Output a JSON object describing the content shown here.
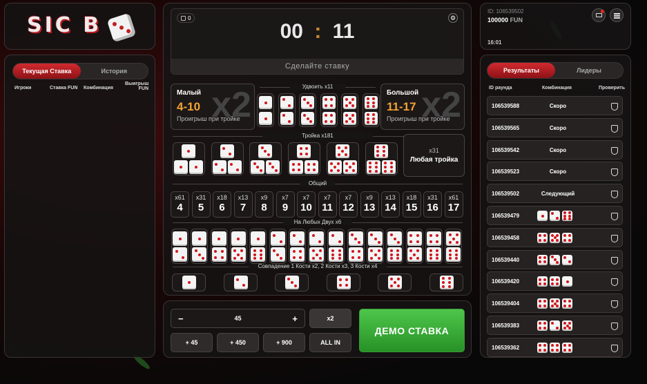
{
  "logo": {
    "text": "SIC B"
  },
  "left": {
    "tab_current": "Текущая Ставка",
    "tab_history": "История",
    "col_players": "Игроки",
    "col_stake": "Ставка FUN",
    "col_combo": "Комбинация",
    "col_win": "Выигрыш FUN"
  },
  "top": {
    "badge_count": "0",
    "timer_min": "00",
    "timer_sep": ":",
    "timer_sec": "11",
    "status": "Сделайте ставку"
  },
  "small": {
    "title": "Малый",
    "range": "4-10",
    "note": "Проигрыш при тройке",
    "mult": "x2"
  },
  "big": {
    "title": "Большой",
    "range": "11-17",
    "note": "Проигрыш при тройке",
    "mult": "x2"
  },
  "sections": {
    "double": "Удвоить x11",
    "triple": "Тройка x181",
    "total": "Общий",
    "two": "На Любых Двух x6",
    "single": "Совпадение 1 Кости x2, 2 Кости x3, 3 Кости x4"
  },
  "any_triple": {
    "mult": "x31",
    "label": "Любая тройка"
  },
  "totals": [
    {
      "m": "x61",
      "n": "4"
    },
    {
      "m": "x31",
      "n": "5"
    },
    {
      "m": "x18",
      "n": "6"
    },
    {
      "m": "x13",
      "n": "7"
    },
    {
      "m": "x9",
      "n": "8"
    },
    {
      "m": "x7",
      "n": "9"
    },
    {
      "m": "x7",
      "n": "10"
    },
    {
      "m": "x7",
      "n": "11"
    },
    {
      "m": "x7",
      "n": "12"
    },
    {
      "m": "x9",
      "n": "13"
    },
    {
      "m": "x13",
      "n": "14"
    },
    {
      "m": "x18",
      "n": "15"
    },
    {
      "m": "x31",
      "n": "16"
    },
    {
      "m": "x61",
      "n": "17"
    }
  ],
  "bet": {
    "minus": "−",
    "amount": "45",
    "plus": "+",
    "double": "x2",
    "add45": "+ 45",
    "add450": "+ 450",
    "add900": "+ 900",
    "allin": "ALL IN",
    "demo": "ДЕМО СТАВКА"
  },
  "account": {
    "id": "ID: 106539502",
    "balance": "100000",
    "currency": "FUN",
    "time": "16:01"
  },
  "right": {
    "tab_results": "Результаты",
    "tab_leaders": "Лидеры",
    "col_round": "ID раунда",
    "col_combo": "Комбинация",
    "col_check": "Проверить"
  },
  "results": [
    {
      "id": "106539588",
      "status": "Скоро",
      "dice": []
    },
    {
      "id": "106539565",
      "status": "Скоро",
      "dice": []
    },
    {
      "id": "106539542",
      "status": "Скоро",
      "dice": []
    },
    {
      "id": "106539523",
      "status": "Скоро",
      "dice": []
    },
    {
      "id": "106539502",
      "status": "Следующий",
      "dice": []
    },
    {
      "id": "106539479",
      "status": "",
      "dice": [
        1,
        2,
        6
      ]
    },
    {
      "id": "106539458",
      "status": "",
      "dice": [
        4,
        5,
        4
      ]
    },
    {
      "id": "106539440",
      "status": "",
      "dice": [
        4,
        3,
        2
      ]
    },
    {
      "id": "106539420",
      "status": "",
      "dice": [
        4,
        4,
        1
      ]
    },
    {
      "id": "106539404",
      "status": "",
      "dice": [
        4,
        5,
        4
      ]
    },
    {
      "id": "106539383",
      "status": "",
      "dice": [
        4,
        2,
        5
      ]
    },
    {
      "id": "106539362",
      "status": "",
      "dice": [
        4,
        4,
        4
      ]
    }
  ],
  "colors": {
    "accent_red": "#c21d22",
    "range_orange": "#f2a233",
    "demo_green": "#3bb33b"
  }
}
